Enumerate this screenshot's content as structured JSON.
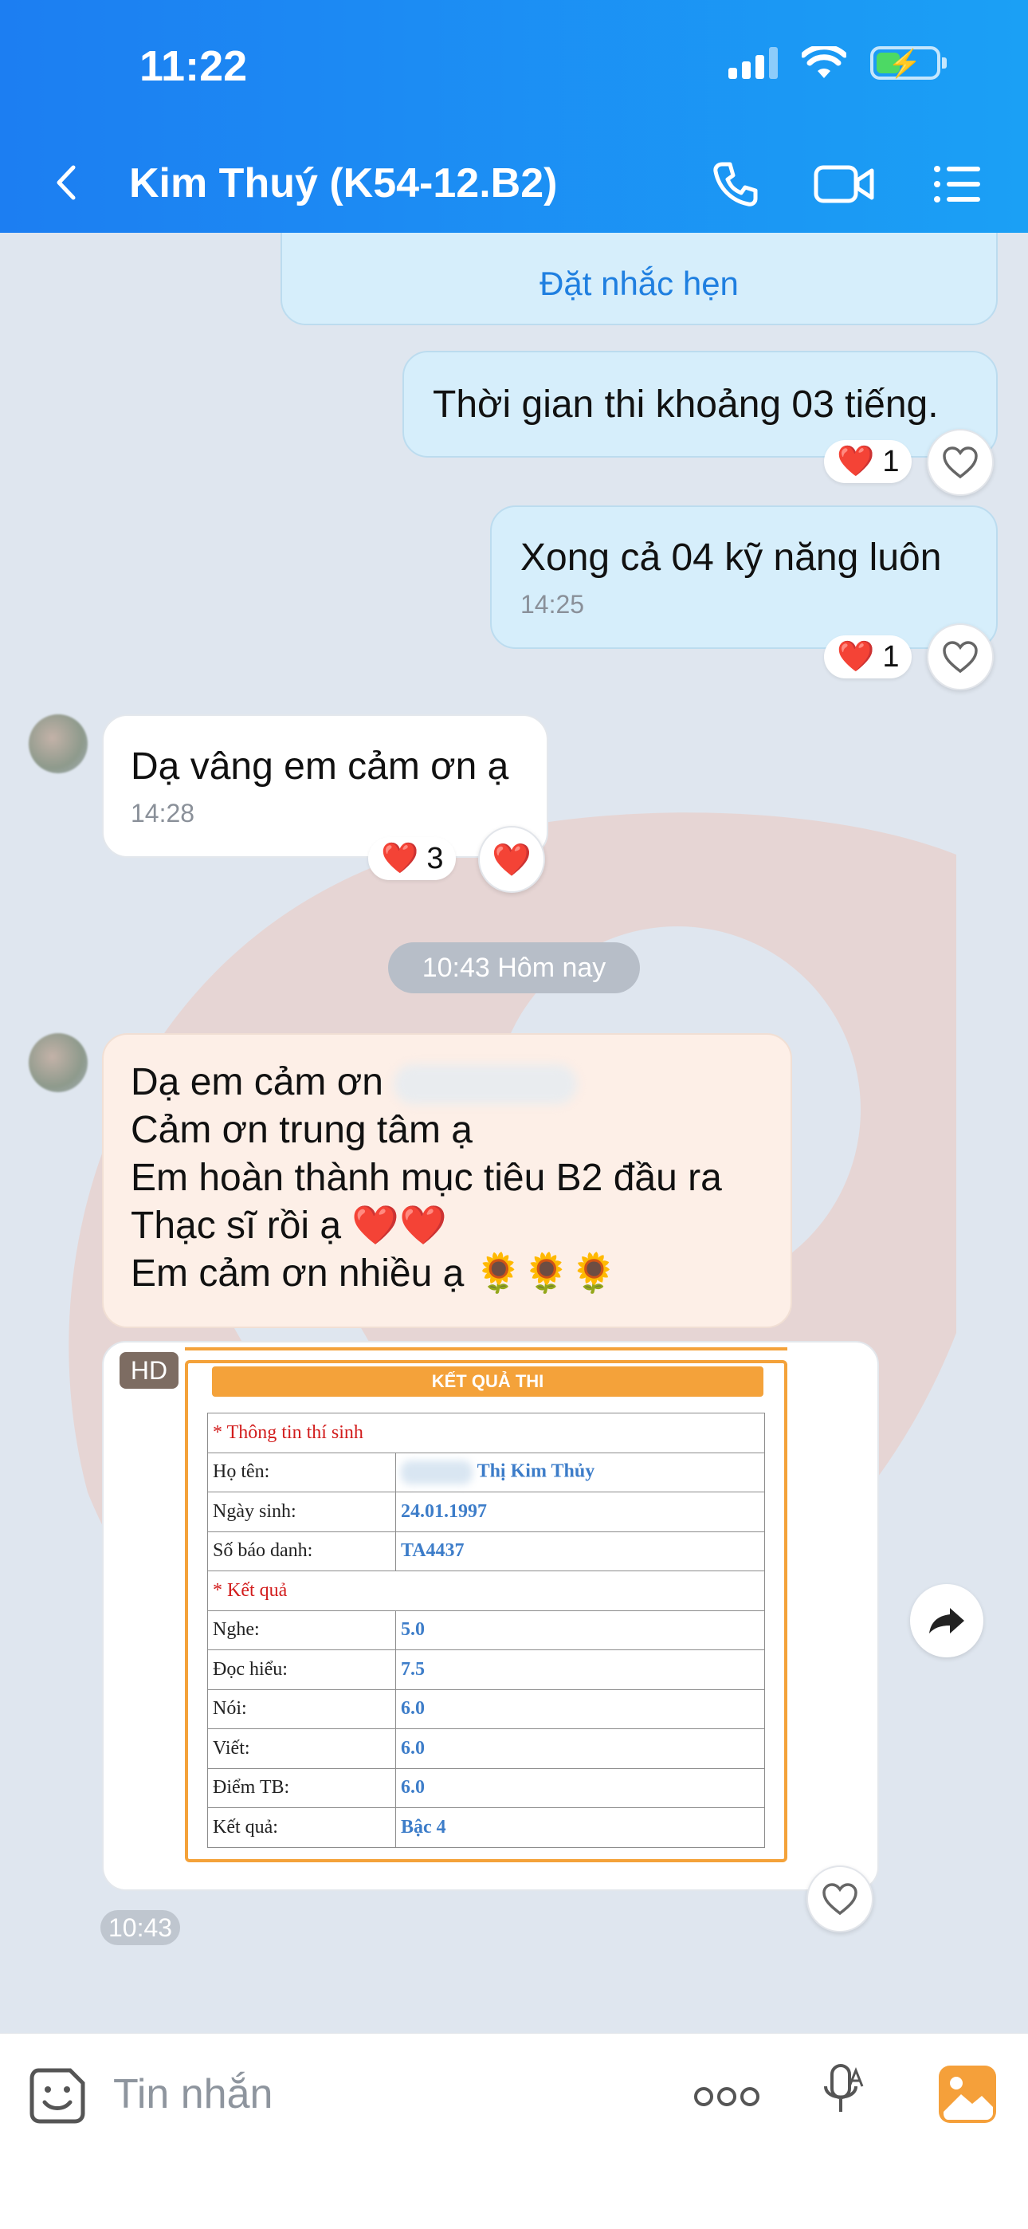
{
  "status_bar": {
    "time": "11:22"
  },
  "header": {
    "title": "Kim Thuý (K54-12.B2)"
  },
  "messages": {
    "reminder_label": "Đặt nhắc hẹn",
    "m1": {
      "text": "Thời gian thi khoảng 03 tiếng.",
      "reaction_count": "1"
    },
    "m2": {
      "text": "Xong cả 04 kỹ năng luôn",
      "time": "14:25",
      "reaction_count": "1"
    },
    "m3": {
      "text": "Dạ vâng em cảm ơn ạ",
      "time": "14:28",
      "reaction_count": "3"
    },
    "day_separator": "10:43 Hôm nay",
    "m4": {
      "line1": "Dạ em cảm ơn",
      "line2": "Cảm ơn trung tâm ạ",
      "line3": "Em hoàn thành mục tiêu B2 đầu ra",
      "line4": "Thạc sĩ rồi ạ ❤️❤️",
      "line5": "Em cảm ơn nhiều ạ 🌻🌻🌻"
    },
    "image": {
      "hd_badge": "HD",
      "time": "10:43",
      "header": "KẾT QUẢ THI",
      "section1": "* Thông tin thí sinh",
      "rows1": [
        {
          "label": "Họ tên:",
          "value": "Thị Kim Thủy"
        },
        {
          "label": "Ngày sinh:",
          "value": "24.01.1997"
        },
        {
          "label": "Số báo danh:",
          "value": "TA4437"
        }
      ],
      "section2": "* Kết quả",
      "rows2": [
        {
          "label": "Nghe:",
          "value": "5.0"
        },
        {
          "label": "Đọc hiểu:",
          "value": "7.5"
        },
        {
          "label": "Nói:",
          "value": "6.0"
        },
        {
          "label": "Viết:",
          "value": "6.0"
        },
        {
          "label": "Điểm TB:",
          "value": "6.0"
        },
        {
          "label": "Kết quả:",
          "value": "Bậc 4"
        }
      ]
    }
  },
  "input": {
    "placeholder": "Tin nhắn"
  },
  "colors": {
    "header_start": "#1c7ef2",
    "header_end": "#1ba0f5",
    "outgoing_bubble": "#d6eefb",
    "accent_orange": "#f4a23a"
  }
}
